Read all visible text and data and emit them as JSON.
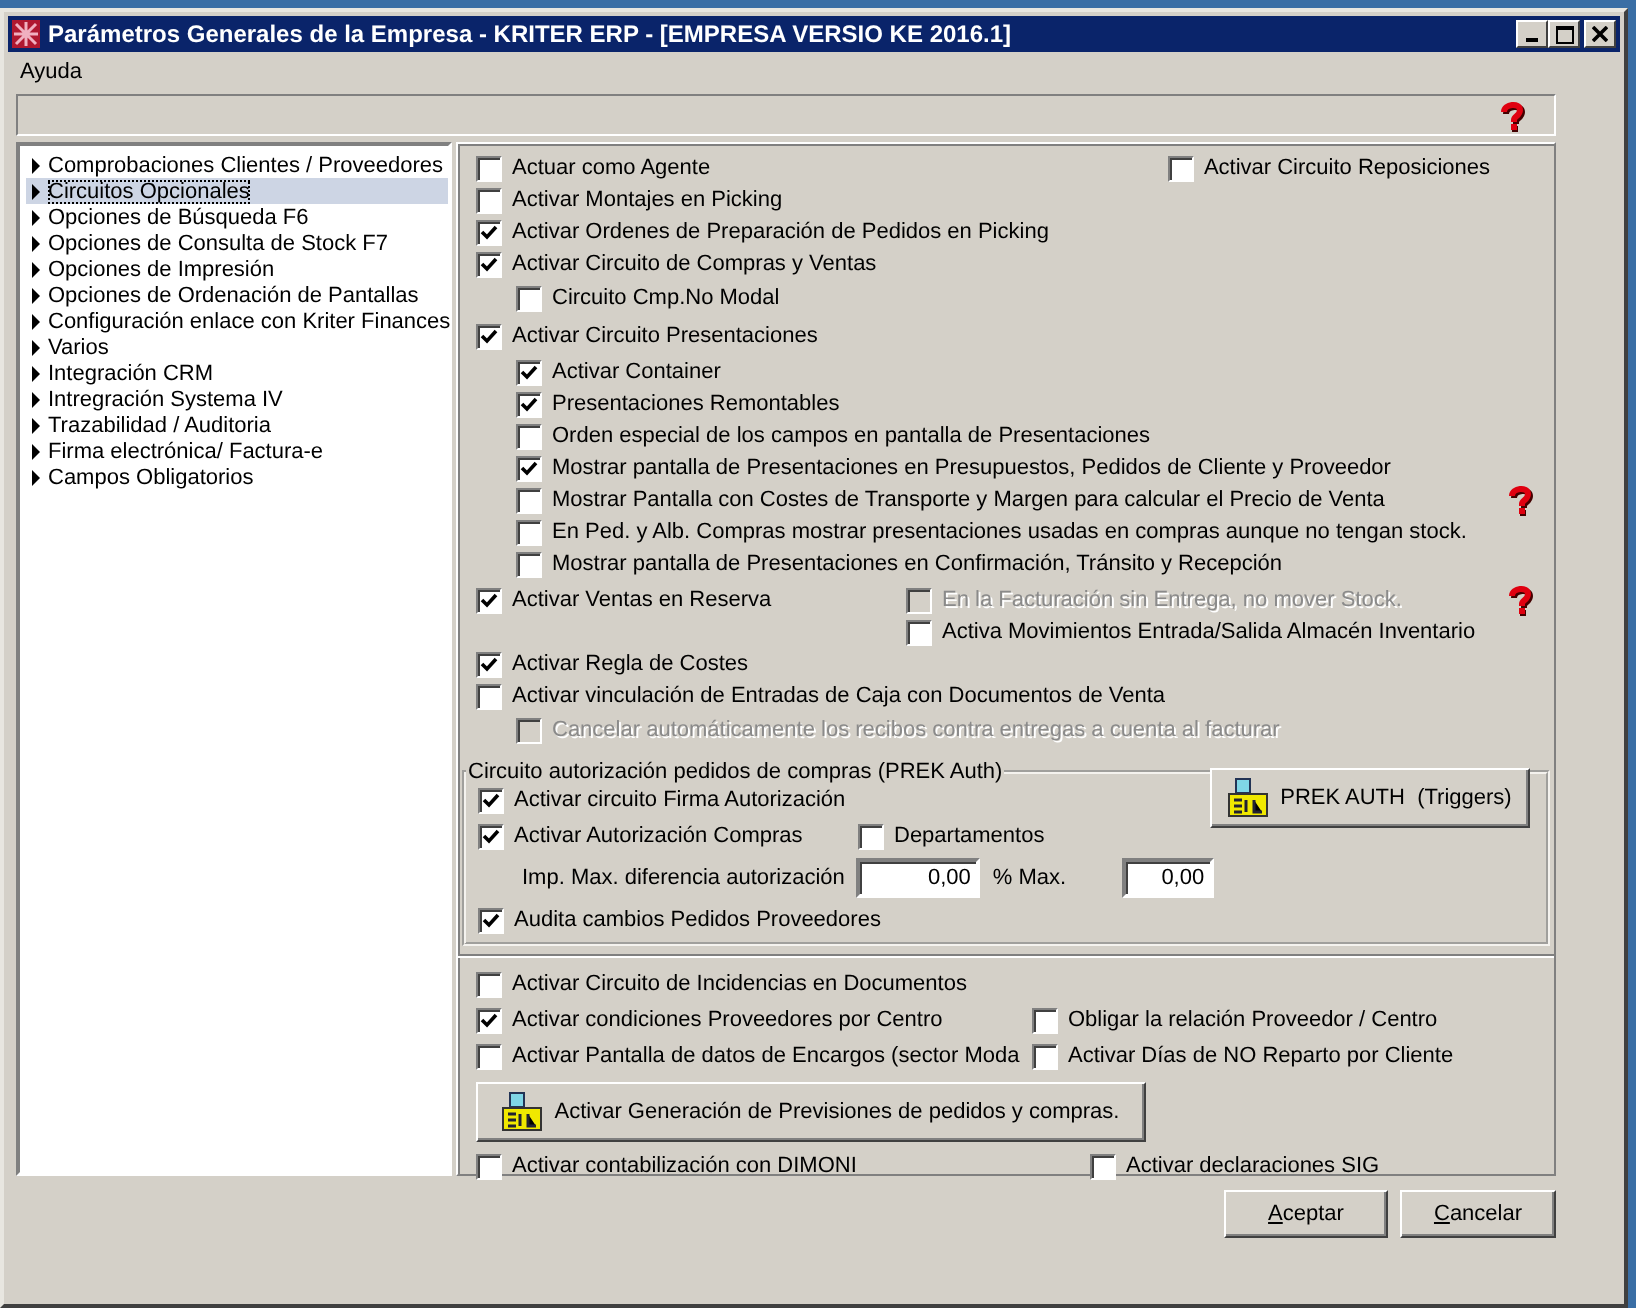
{
  "window": {
    "title": "Parámetros Generales de la Empresa - KRITER ERP - [EMPRESA VERSIO KE 2016.1]"
  },
  "menu": [
    {
      "label": "Ayuda"
    }
  ],
  "sidebar": {
    "items": [
      {
        "label": "Comprobaciones Clientes / Proveedores",
        "selected": false
      },
      {
        "label": "Circuitos Opcionales",
        "selected": true
      },
      {
        "label": "Opciones de Búsqueda F6",
        "selected": false
      },
      {
        "label": "Opciones de Consulta de Stock F7",
        "selected": false
      },
      {
        "label": "Opciones de Impresión",
        "selected": false
      },
      {
        "label": "Opciones de Ordenación de Pantallas",
        "selected": false
      },
      {
        "label": "Configuración enlace con Kriter Finances",
        "selected": false
      },
      {
        "label": "Varios",
        "selected": false
      },
      {
        "label": "Integración CRM",
        "selected": false
      },
      {
        "label": "Intregración Systema IV",
        "selected": false
      },
      {
        "label": "Trazabilidad / Auditoria",
        "selected": false
      },
      {
        "label": "Firma electrónica/ Factura-e",
        "selected": false
      },
      {
        "label": "Campos Obligatorios",
        "selected": false
      }
    ]
  },
  "options": [
    {
      "label": "Actuar como Agente",
      "checked": false,
      "aside": {
        "label": "Activar Circuito Reposiciones",
        "checked": false
      }
    },
    {
      "label": "Activar Montajes en Picking",
      "checked": false
    },
    {
      "label": "Activar Ordenes de Preparación de Pedidos en Picking",
      "checked": true
    },
    {
      "label": "Activar Circuito de Compras y Ventas",
      "checked": true,
      "children": [
        {
          "label": "Circuito Cmp.No Modal",
          "checked": false
        }
      ]
    },
    {
      "label": "Activar Circuito Presentaciones",
      "checked": true,
      "children": [
        {
          "label": "Activar Container",
          "checked": true,
          "help": false
        },
        {
          "label": "Presentaciones Remontables",
          "checked": true,
          "help": false
        },
        {
          "label": "Orden especial de los campos en pantalla de Presentaciones",
          "checked": false,
          "help": false
        },
        {
          "label": "Mostrar pantalla de Presentaciones en Presupuestos, Pedidos de Cliente y Proveedor",
          "checked": true,
          "help": false
        },
        {
          "label": "Mostrar Pantalla con Costes de Transporte y Margen para calcular el Precio de Venta",
          "checked": false,
          "help": true
        },
        {
          "label": "En Ped. y Alb. Compras mostrar presentaciones usadas en compras aunque no tengan stock.",
          "checked": false,
          "help": false
        },
        {
          "label": "Mostrar pantalla de Presentaciones en Confirmación, Tránsito y Recepción",
          "checked": false,
          "help": false
        }
      ]
    },
    {
      "label": "Activar Ventas en Reserva",
      "checked": true,
      "extra": [
        {
          "label": "En la Facturación sin Entrega, no mover Stock.",
          "checked": false,
          "disabled": true,
          "help": true
        },
        {
          "label": "Activa Movimientos Entrada/Salida Almacén Inventario",
          "checked": false,
          "disabled": false,
          "help": false
        }
      ]
    },
    {
      "label": "Activar Regla de Costes",
      "checked": true
    },
    {
      "label": "Activar vinculación de Entradas de Caja con Documentos de Venta",
      "checked": false,
      "children": [
        {
          "label": "Cancelar automáticamente los recibos contra entregas a cuenta al facturar",
          "checked": false,
          "disabled": true
        }
      ]
    }
  ],
  "auth_group": {
    "title": "Circuito autorización  pedidos de compras (PREK Auth)",
    "checks": [
      {
        "label": "Activar circuito Firma Autorización",
        "checked": true
      },
      {
        "label": "Activar Autorización Compras",
        "checked": true
      },
      {
        "label": "Audita cambios Pedidos Proveedores",
        "checked": true
      }
    ],
    "departments": {
      "label": "Departamentos",
      "checked": false
    },
    "button": {
      "label": "PREK AUTH  (Triggers)"
    },
    "limit": {
      "label": "Imp. Max. diferencia autorización",
      "value": "0,00"
    },
    "percent": {
      "label": "% Max.",
      "value": "0,00"
    }
  },
  "more_options": [
    {
      "label": "Activar Circuito de Incidencias en Documentos",
      "checked": false
    },
    {
      "label": "Activar condiciones Proveedores por Centro",
      "checked": true,
      "aside": {
        "label": "Obligar la relación Proveedor / Centro",
        "checked": false
      }
    },
    {
      "label": "Activar Pantalla de datos de Encargos (sector Moda",
      "checked": false,
      "aside": {
        "label": "Activar Días de NO Reparto por Cliente",
        "checked": false
      }
    }
  ],
  "forecast_button": {
    "label": "Activar Generación de Previsiones de pedidos y compras."
  },
  "footer_options": [
    {
      "label": "Activar contabilización con DIMONI",
      "checked": false
    },
    {
      "label": "Activar declaraciones SIG",
      "checked": false
    }
  ],
  "buttons": [
    {
      "label": "Aceptar"
    },
    {
      "label": "Cancelar"
    }
  ]
}
